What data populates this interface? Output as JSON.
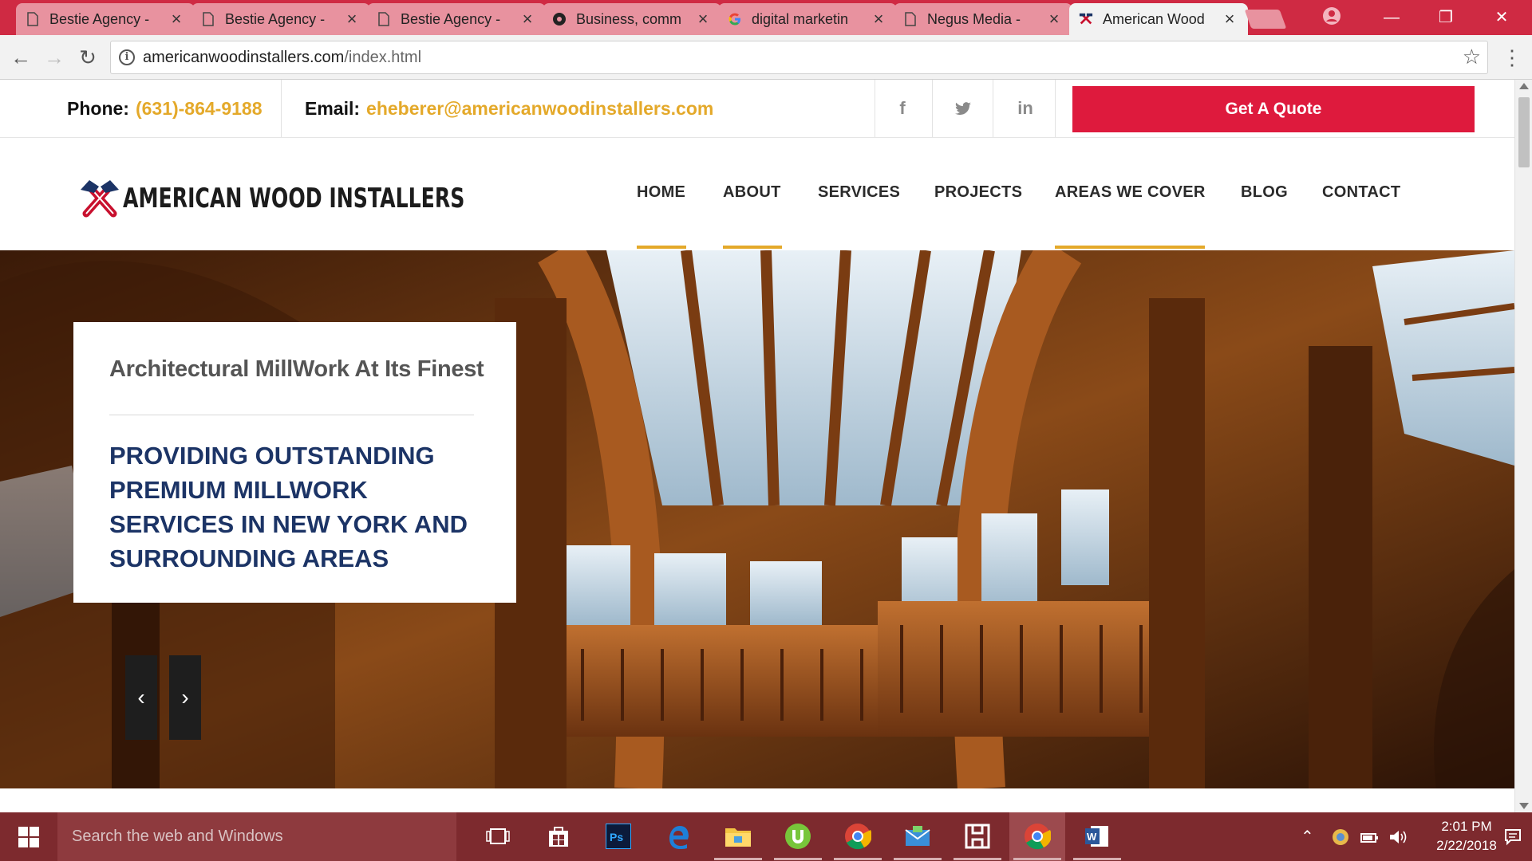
{
  "browser": {
    "tabs": [
      {
        "title": "Bestie Agency -",
        "icon": "page-icon",
        "close": "×"
      },
      {
        "title": "Bestie Agency -",
        "icon": "page-icon",
        "close": "×"
      },
      {
        "title": "Bestie Agency -",
        "icon": "page-icon",
        "close": "×"
      },
      {
        "title": "Business, comm",
        "icon": "site-icon",
        "close": "×"
      },
      {
        "title": "digital marketin",
        "icon": "google-icon",
        "close": "×"
      },
      {
        "title": "Negus Media - ",
        "icon": "page-icon",
        "close": "×"
      },
      {
        "title": "American Wood",
        "icon": "hammer-favicon",
        "close": "×",
        "active": true
      }
    ],
    "url_host": "americanwoodinstallers.com",
    "url_path": "/index.html",
    "accent_color": "#cf2a43"
  },
  "topbar": {
    "phone_label": "Phone:",
    "phone_value": "(631)-864-9188",
    "email_label": "Email:",
    "email_value": "eheberer@americanwoodinstallers.com",
    "social": [
      "f",
      "t",
      "in"
    ],
    "quote_button": "Get A Quote",
    "quote_color": "#de1a3d",
    "highlight_color": "#e4a92a"
  },
  "header": {
    "logo_text": "AMERICAN WOOD INSTALLERS",
    "nav": [
      "HOME",
      "ABOUT",
      "SERVICES",
      "PROJECTS",
      "AREAS WE COVER",
      "BLOG",
      "CONTACT"
    ]
  },
  "hero": {
    "subhead": "Architectural MillWork At Its Finest",
    "headline": "PROVIDING OUTSTANDING PREMIUM MILLWORK SERVICES IN NEW YORK AND SURROUNDING AREAS",
    "prev": "‹",
    "next": "›",
    "headline_color": "#1c3466"
  },
  "taskbar": {
    "search_placeholder": "Search the web and Windows",
    "time": "2:01 PM",
    "date": "2/22/2018",
    "apps": [
      "task-view-icon",
      "store-icon",
      "photoshop-icon",
      "edge-icon",
      "file-explorer-icon",
      "utorrent-icon",
      "chrome-icon",
      "mail-icon",
      "app-icon",
      "chrome-icon",
      "word-icon"
    ]
  }
}
